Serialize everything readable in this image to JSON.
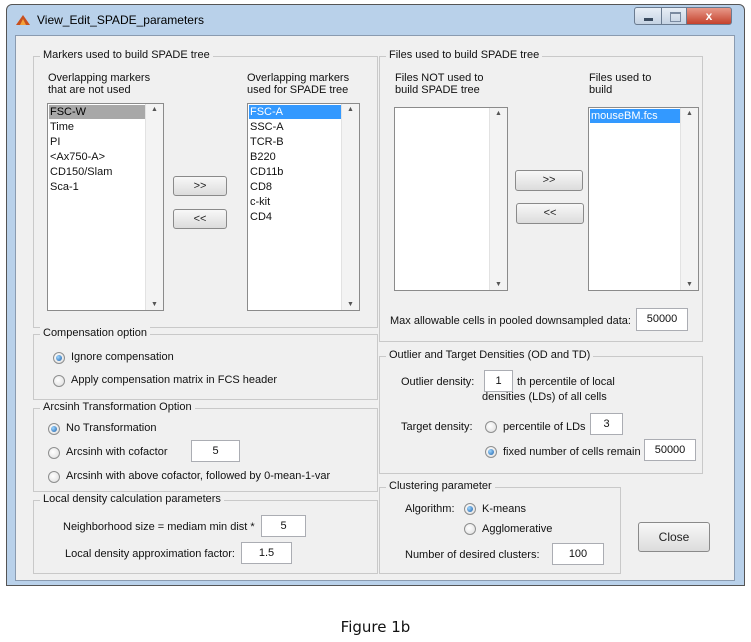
{
  "window": {
    "title": "View_Edit_SPADE_parameters",
    "close_glyph": "x",
    "colors": {
      "selection_blue": "#3399ff",
      "selection_gray": "#a8a8a8",
      "face": "#f0f0f0"
    }
  },
  "markers": {
    "group_title": "Markers used to build SPADE tree",
    "unused_header_1": "Overlapping markers",
    "unused_header_2": "that are not used",
    "used_header_1": "Overlapping markers",
    "used_header_2": "used for SPADE tree",
    "unused_items": [
      "FSC-W",
      "Time",
      "PI",
      "<Ax750-A>",
      "CD150/Slam",
      "Sca-1"
    ],
    "used_items": [
      "FSC-A",
      "SSC-A",
      "TCR-B",
      "B220",
      "CD11b",
      "CD8",
      "c-kit",
      "CD4"
    ],
    "add_label": ">>",
    "remove_label": "<<"
  },
  "files": {
    "group_title": "Files used to build SPADE tree",
    "unused_header_1": "Files NOT used to",
    "unused_header_2": "build SPADE tree",
    "used_header_1": "Files used to",
    "used_header_2": "build",
    "unused_items": [],
    "used_items": [
      "mouseBM.fcs"
    ],
    "add_label": ">>",
    "remove_label": "<<",
    "max_cells_label": "Max allowable cells in pooled downsampled data:",
    "max_cells_value": "50000"
  },
  "compensation": {
    "group_title": "Compensation option",
    "options": [
      "Ignore compensation",
      "Apply compensation matrix in FCS header"
    ],
    "selected": 0
  },
  "arcsinh": {
    "group_title": "Arcsinh Transformation Option",
    "options": [
      "No Transformation",
      "Arcsinh with cofactor",
      "Arcsinh with above cofactor, followed by 0-mean-1-var"
    ],
    "selected": 0,
    "cofactor_value": "5"
  },
  "local_density": {
    "group_title": "Local density calculation parameters",
    "neighborhood_label": "Neighborhood size = mediam min dist *",
    "neighborhood_value": "5",
    "approx_label": "Local density approximation factor:",
    "approx_value": "1.5"
  },
  "densities": {
    "group_title": "Outlier and Target Densities (OD and TD)",
    "outlier_label": "Outlier density:",
    "outlier_value": "1",
    "outlier_suffix_1": "th percentile of local",
    "outlier_suffix_2": "densities (LDs) of all cells",
    "target_label": "Target density:",
    "target_options": [
      "percentile of LDs",
      "fixed number of cells remain"
    ],
    "target_selected": 1,
    "percentile_value": "3",
    "fixed_value": "50000"
  },
  "clustering": {
    "group_title": "Clustering parameter",
    "algorithm_label": "Algorithm:",
    "algorithms": [
      "K-means",
      "Agglomerative"
    ],
    "selected": 0,
    "clusters_label": "Number of desired clusters:",
    "clusters_value": "100"
  },
  "close_button": "Close",
  "caption": "Figure 1b"
}
